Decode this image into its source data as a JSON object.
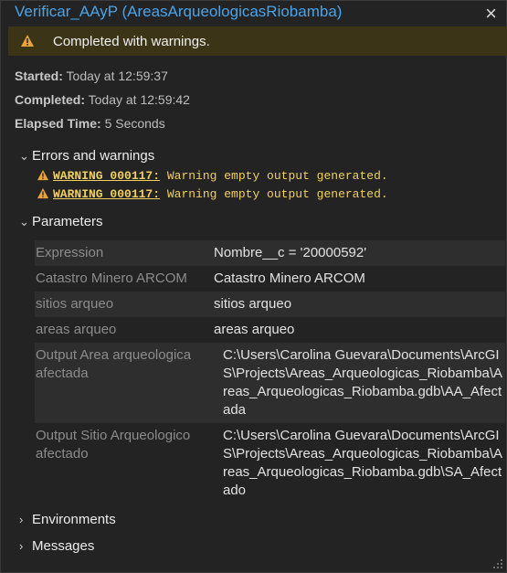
{
  "window": {
    "title": "Verificar_AAyP (AreasArqueologicasRiobamba)",
    "close": "×"
  },
  "banner": {
    "message": "Completed with warnings."
  },
  "meta": {
    "started_label": "Started:",
    "started_value": "Today at 12:59:37",
    "completed_label": "Completed:",
    "completed_value": "Today at 12:59:42",
    "elapsed_label": "Elapsed Time:",
    "elapsed_value": "5 Seconds"
  },
  "sections": {
    "errors": "Errors and warnings",
    "parameters": "Parameters",
    "environments": "Environments",
    "messages": "Messages"
  },
  "warnings": [
    {
      "code": "WARNING 000117:",
      "text": "Warning empty output generated."
    },
    {
      "code": "WARNING 000117:",
      "text": "Warning empty output generated."
    }
  ],
  "parameters": [
    {
      "name": "Expression",
      "value": "Nombre__c = '20000592'"
    },
    {
      "name": "Catastro Minero ARCOM",
      "value": "Catastro Minero ARCOM"
    },
    {
      "name": "sitios arqueo",
      "value": "sitios arqueo"
    },
    {
      "name": "areas arqueo",
      "value": "areas arqueo"
    },
    {
      "name": "Output Area arqueologica afectada",
      "value": "C:\\Users\\Carolina Guevara\\Documents\\ArcGIS\\Projects\\Areas_Arqueologicas_Riobamba\\Areas_Arqueologicas_Riobamba.gdb\\AA_Afectada"
    },
    {
      "name": "Output Sitio Arqueologico afectado",
      "value": "C:\\Users\\Carolina Guevara\\Documents\\ArcGIS\\Projects\\Areas_Arqueologicas_Riobamba\\Areas_Arqueologicas_Riobamba.gdb\\SA_Afectado"
    }
  ],
  "colors": {
    "accent": "#4aa3e8",
    "warning": "#f0d060",
    "banner_bg": "#3b3416"
  }
}
